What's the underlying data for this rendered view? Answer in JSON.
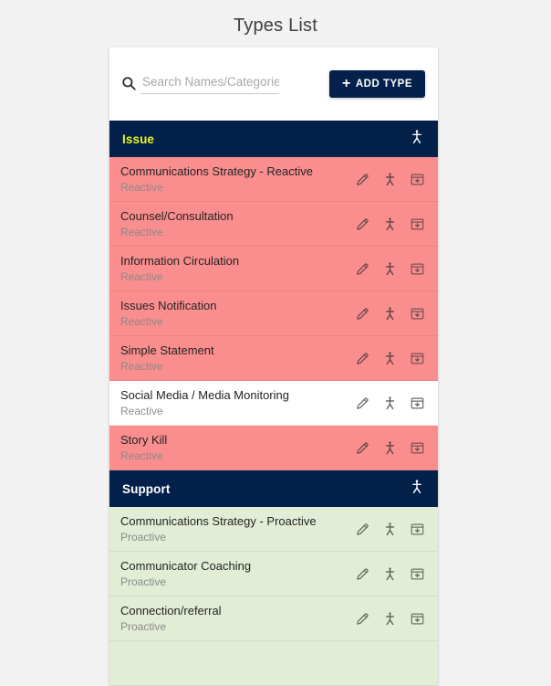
{
  "page": {
    "title": "Types List"
  },
  "toolbar": {
    "search_placeholder": "Search Names/Categories..",
    "search_value": "",
    "search_icon": "search-icon",
    "add_button_label": "ADD TYPE",
    "add_button_plus": "+",
    "add_button_color": "#05214b"
  },
  "colors": {
    "navy": "#03204b",
    "accent_yellow": "#eaf520",
    "reactive_row": "#fa8e8e",
    "proactive_row": "#e2edd5",
    "hovered_row": "#ffffff",
    "page_background": "#f2f2f2"
  },
  "row_actions": [
    {
      "name": "edit-button",
      "icon": "pencil-icon"
    },
    {
      "name": "assign-person-button",
      "icon": "person-icon"
    },
    {
      "name": "archive-button",
      "icon": "archive-down-arrow-icon"
    }
  ],
  "groups": [
    {
      "label": "Issue",
      "label_color": "accent-yellow",
      "header_icon": "person-icon",
      "rows": [
        {
          "name": "Communications Strategy - Reactive",
          "category": "Reactive",
          "state": "reactive"
        },
        {
          "name": "Counsel/Consultation",
          "category": "Reactive",
          "state": "reactive"
        },
        {
          "name": "Information Circulation",
          "category": "Reactive",
          "state": "reactive"
        },
        {
          "name": "Issues Notification",
          "category": "Reactive",
          "state": "reactive"
        },
        {
          "name": "Simple Statement",
          "category": "Reactive",
          "state": "reactive"
        },
        {
          "name": "Social Media / Media Monitoring",
          "category": "Reactive",
          "state": "hovered"
        },
        {
          "name": "Story Kill",
          "category": "Reactive",
          "state": "reactive"
        }
      ]
    },
    {
      "label": "Support",
      "label_color": "accent-white",
      "header_icon": "person-icon",
      "rows": [
        {
          "name": "Communications Strategy - Proactive",
          "category": "Proactive",
          "state": "proactive"
        },
        {
          "name": "Communicator Coaching",
          "category": "Proactive",
          "state": "proactive"
        },
        {
          "name": "Connection/referral",
          "category": "Proactive",
          "state": "proactive"
        },
        {
          "name": "",
          "category": "",
          "state": "proactive"
        }
      ]
    }
  ]
}
